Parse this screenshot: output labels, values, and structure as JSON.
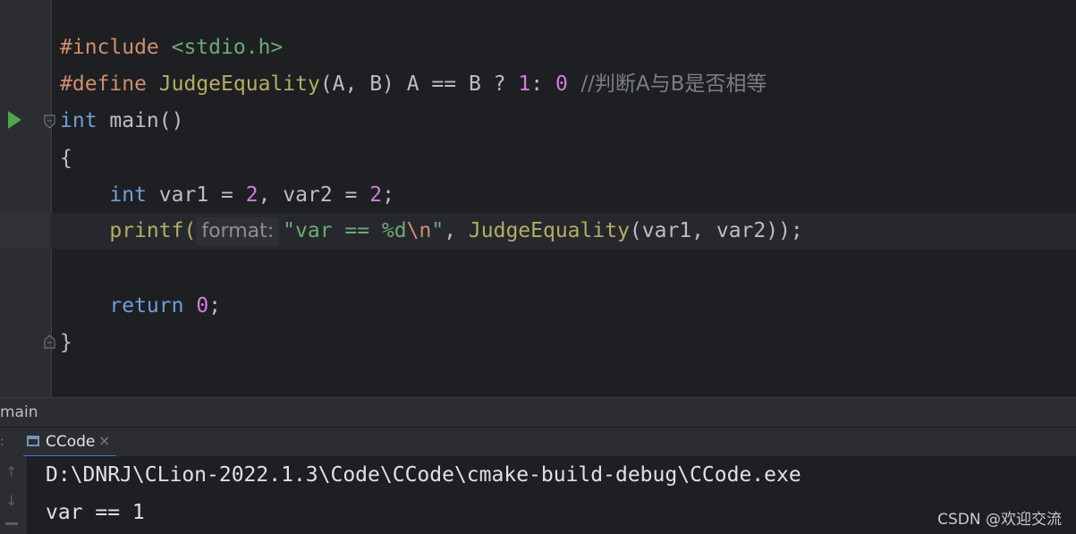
{
  "editor": {
    "line_include": {
      "directive": "#include",
      "header": "<stdio.h>"
    },
    "line_define": {
      "directive": "#define",
      "macro": "JudgeEquality",
      "params": "(A, B) A == B ? ",
      "one": "1",
      "colon": ": ",
      "zero": "0",
      "comment": "  //判断A与B是否相等"
    },
    "line_main": {
      "type": "int",
      "signature": " main()"
    },
    "line_open_brace": "{",
    "line_vars": {
      "indent": "    ",
      "type": "int",
      "text1": " var1 = ",
      "val1": "2",
      "text2": ", var2 = ",
      "val2": "2",
      "end": ";"
    },
    "line_printf": {
      "indent": "    ",
      "fn": "printf(",
      "hint": "format:",
      "str1": "\"var == %d",
      "esc": "\\n",
      "str2": "\"",
      "comma": ", ",
      "macro": "JudgeEquality",
      "args": "(var1, var2));"
    },
    "line_return": {
      "indent": "    ",
      "kw": "return",
      "space": " ",
      "val": "0",
      "end": ";"
    },
    "line_close_brace": "}"
  },
  "breadcrumb": {
    "label": "main"
  },
  "run_window": {
    "tab_label": "CCode",
    "close_glyph": "×",
    "left_tool_glyph": ":",
    "up_arrow": "↑",
    "down_arrow": "↓",
    "output": [
      "D:\\DNRJ\\CLion-2022.1.3\\Code\\CCode\\cmake-build-debug\\CCode.exe",
      "var == 1"
    ]
  },
  "watermark": "CSDN @欢迎交流",
  "colors": {
    "run_icon": "#4fa84a",
    "tab_underline": "#3574f0",
    "background": "#1e1f22"
  }
}
